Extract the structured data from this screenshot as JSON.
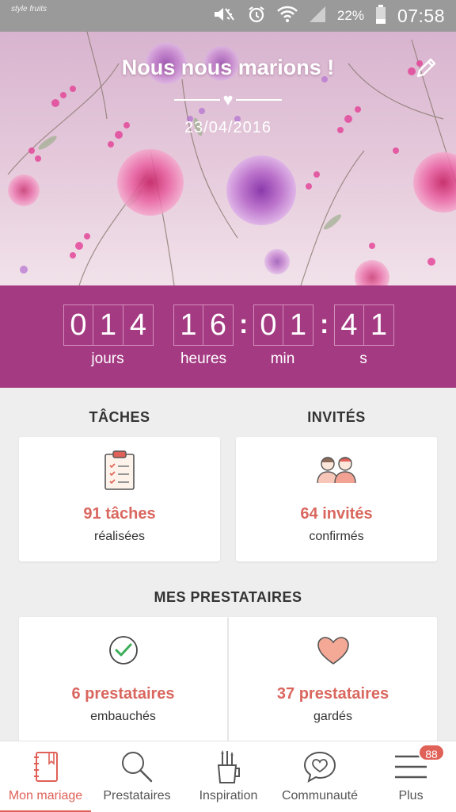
{
  "status_bar": {
    "app_logo": "style fruits",
    "battery": "22%",
    "time": "07:58"
  },
  "header": {
    "title": "Nous nous marions !",
    "date": "23/04/2016"
  },
  "countdown": {
    "days": [
      "0",
      "1",
      "4"
    ],
    "hours": [
      "1",
      "6"
    ],
    "minutes": [
      "0",
      "1"
    ],
    "seconds": [
      "4",
      "1"
    ],
    "labels": {
      "days": "jours",
      "hours": "heures",
      "minutes": "min",
      "seconds": "s"
    }
  },
  "taches": {
    "title": "TÂCHES",
    "stat": "91 tâches",
    "sub": "réalisées"
  },
  "invites": {
    "title": "INVITÉS",
    "stat": "64 invités",
    "sub": "confirmés"
  },
  "prestataires": {
    "title": "MES PRESTATAIRES",
    "hired": {
      "stat": "6 prestataires",
      "sub": "embauchés"
    },
    "saved": {
      "stat": "37 prestataires",
      "sub": "gardés"
    }
  },
  "nav": {
    "items": [
      {
        "label": "Mon mariage",
        "icon": "notebook-icon"
      },
      {
        "label": "Prestataires",
        "icon": "search-icon"
      },
      {
        "label": "Inspiration",
        "icon": "pencil-cup-icon"
      },
      {
        "label": "Communauté",
        "icon": "chat-heart-icon"
      },
      {
        "label": "Plus",
        "icon": "menu-icon"
      }
    ],
    "badge": "88"
  },
  "colors": {
    "accent": "#e06157",
    "countdown_bg": "#a43a82",
    "stat_text": "#d9675f"
  }
}
